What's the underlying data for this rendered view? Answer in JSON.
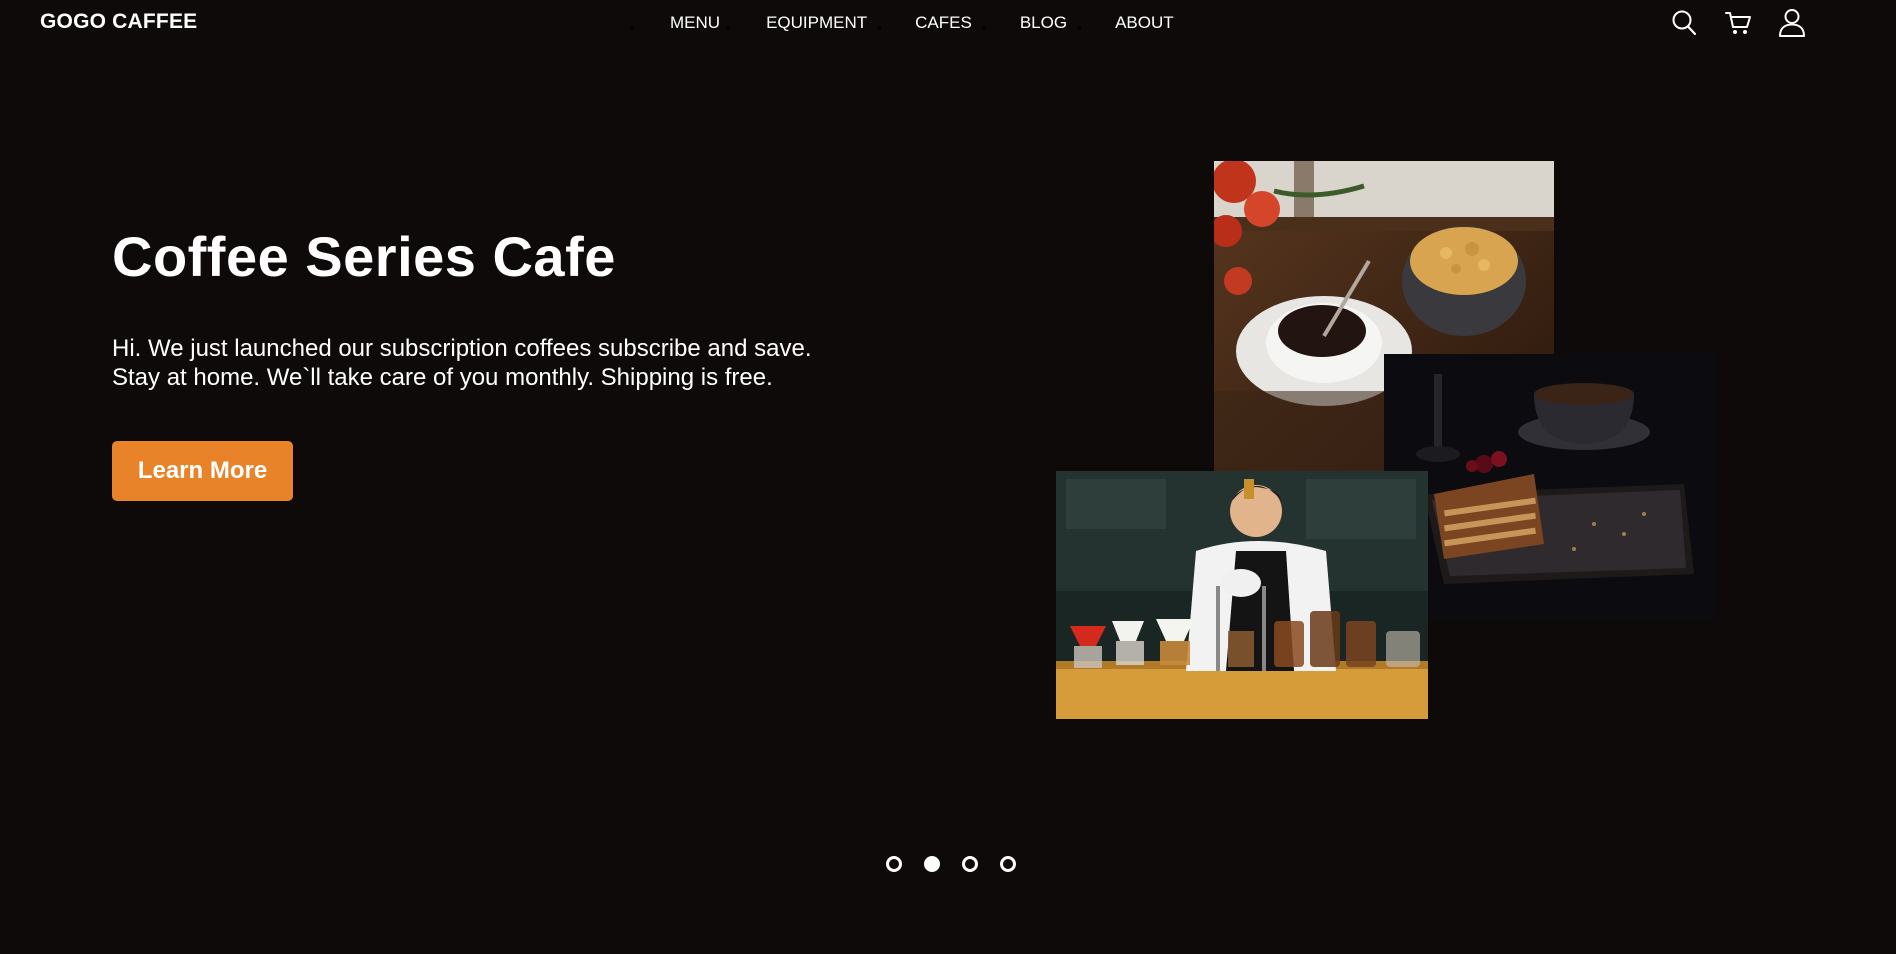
{
  "brand": {
    "name": "GOGO CAFFEE"
  },
  "nav": {
    "items": [
      {
        "label": "MENU"
      },
      {
        "label": "EQUIPMENT"
      },
      {
        "label": "CAFES"
      },
      {
        "label": "BLOG"
      },
      {
        "label": "ABOUT"
      }
    ]
  },
  "header_icons": [
    "search-icon",
    "cart-icon",
    "user-icon"
  ],
  "hero": {
    "title": "Coffee Series Cafe",
    "description_line1": "Hi. We just launched our subscription coffees subscribe and save.",
    "description_line2": "Stay at home. We`ll take care of you monthly. Shipping is free.",
    "cta_label": "Learn More"
  },
  "carousel": {
    "slides": 4,
    "active_index": 1
  },
  "colors": {
    "background": "#0f0a0a",
    "accent": "#e8832a",
    "text": "#ffffff"
  }
}
